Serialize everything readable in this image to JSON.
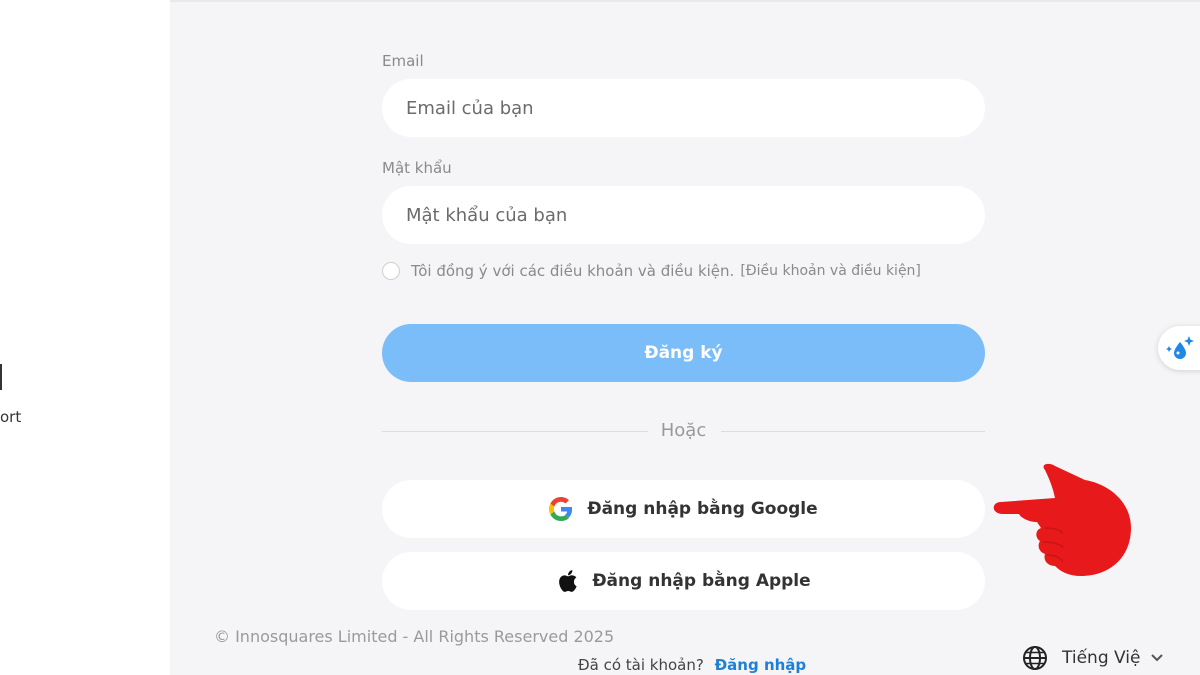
{
  "left_panel": {
    "partial_text": "ort"
  },
  "form": {
    "email_label": "Email",
    "email_placeholder": "Email của bạn",
    "password_label": "Mật khẩu",
    "password_placeholder": "Mật khẩu của bạn",
    "terms_text": "Tôi đồng ý với các điều khoản và điều kiện.",
    "terms_link": "[Điều khoản và điều kiện]",
    "signup_label": "Đăng ký",
    "or_text": "Hoặc",
    "google_label": "Đăng nhập bằng Google",
    "apple_label": "Đăng nhập bằng Apple"
  },
  "footer": {
    "copyright": "© Innosquares Limited - All Rights Reserved 2025",
    "have_account": "Đã có tài khoản?",
    "login_link": "Đăng nhập",
    "language": "Tiếng Việ"
  },
  "colors": {
    "primary_button": "#7bbdf9",
    "link": "#1e7fd6",
    "annotation_hand": "#e8191a"
  },
  "icons": [
    "google-icon",
    "apple-icon",
    "globe-icon",
    "chevron-down-icon",
    "sparkle-drop-icon",
    "pointing-hand-icon"
  ]
}
